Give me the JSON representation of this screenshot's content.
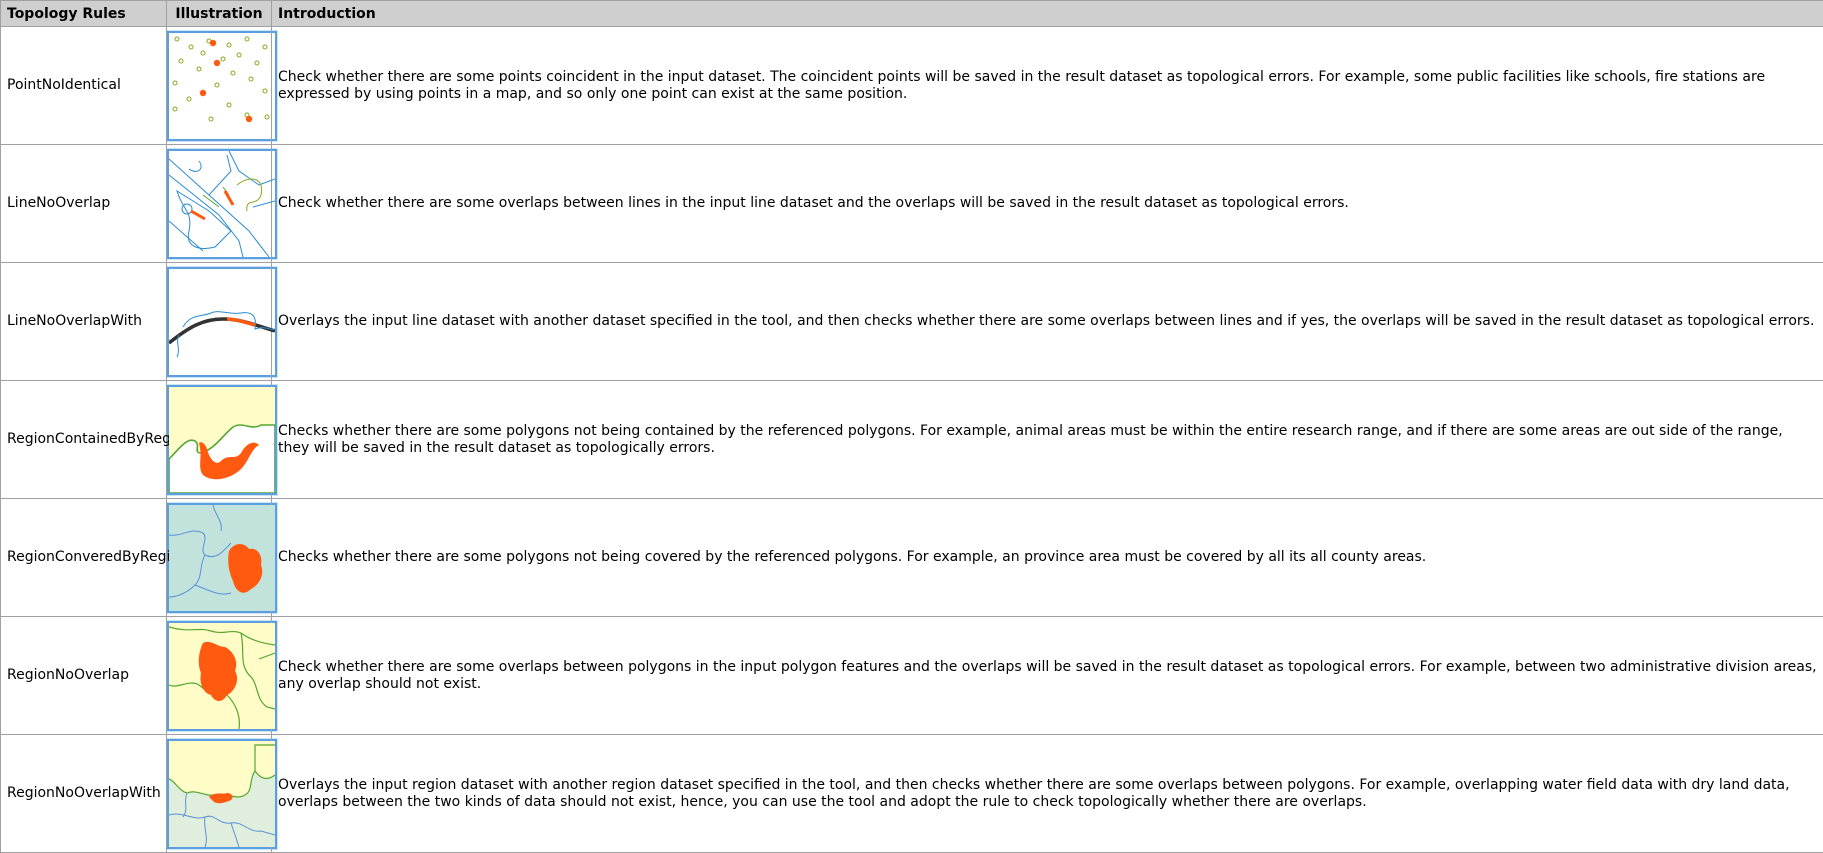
{
  "headers": {
    "rule": "Topology Rules",
    "illustration": "Illustration",
    "introduction": "Introduction"
  },
  "rows": [
    {
      "name": "PointNoIdentical",
      "icon": "point-no-identical-illustration",
      "intro": "Check whether there are some points coincident in the input dataset. The coincident points will be saved in the result dataset as topological errors. For example, some public facilities like schools, fire stations are expressed by using points in a map, and so only one point can exist at the same position."
    },
    {
      "name": "LineNoOverlap",
      "icon": "line-no-overlap-illustration",
      "intro": "Check whether there are some overlaps between lines in the input line dataset and the overlaps will be saved in the result dataset as topological errors."
    },
    {
      "name": "LineNoOverlapWith",
      "icon": "line-no-overlap-with-illustration",
      "intro": "Overlays the input line dataset with another dataset specified in the tool, and then checks whether there are some overlaps between lines and if yes, the overlaps will be saved in the result dataset as topological errors."
    },
    {
      "name": "RegionContainedByRegion",
      "icon": "region-contained-by-region-illustration",
      "intro": "Checks whether there are some polygons not being contained by the referenced polygons. For example, animal areas must be within the entire research range, and if there are some areas are out side of the range, they will be saved in the result dataset as topologically errors."
    },
    {
      "name": "RegionConveredByRegion",
      "icon": "region-covered-by-region-illustration",
      "intro": "Checks whether there are some polygons not being covered by the referenced polygons. For example, an province area must be covered by all its all county areas."
    },
    {
      "name": "RegionNoOverlap",
      "icon": "region-no-overlap-illustration",
      "intro": "Check whether there are some overlaps between polygons in the input polygon features and the overlaps will be saved in the result dataset as topological errors. For example, between two administrative division areas, any overlap should not exist."
    },
    {
      "name": "RegionNoOverlapWith",
      "icon": "region-no-overlap-with-illustration",
      "intro": "Overlays the input region dataset with another region dataset specified in the tool, and then checks whether there are some overlaps between polygons. For example, overlapping water field data with dry land data, overlaps between the two kinds of data should not exist, hence, you can use the tool and adopt the rule to check topologically whether there are overlaps."
    }
  ],
  "colors": {
    "error": "#ff5a10",
    "reference_line": "#55a630",
    "line": "#2a8cd0",
    "region_fill": "#fffcc8",
    "water_fill": "#c2e3dc"
  }
}
